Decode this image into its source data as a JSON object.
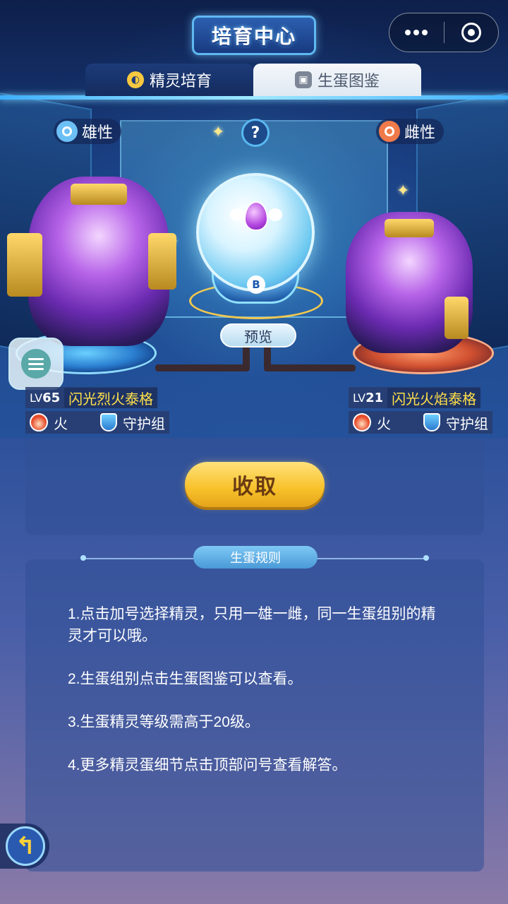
{
  "header": {
    "title": "培育中心",
    "capsule": {
      "more_icon": "more-dots-icon",
      "close_icon": "target-close-icon"
    }
  },
  "tabs": [
    {
      "label": "精灵培育",
      "active": true,
      "icon": "sprite-icon"
    },
    {
      "label": "生蛋图鉴",
      "active": false,
      "icon": "book-icon"
    }
  ],
  "parents": {
    "male": {
      "gender_label": "雄性",
      "level_prefix": "LV",
      "level": "65",
      "name": "闪光烈火泰格",
      "attribute": "火",
      "egg_group": "守护组"
    },
    "female": {
      "gender_label": "雌性",
      "level_prefix": "LV",
      "level": "21",
      "name": "闪光火焰泰格",
      "attribute": "火",
      "egg_group": "守护组"
    }
  },
  "center": {
    "help_label": "?",
    "egg_badge": "B",
    "preview_label": "预览"
  },
  "actions": {
    "collect_label": "收取"
  },
  "rules": {
    "title": "生蛋规则",
    "items": [
      "1.点击加号选择精灵，只用一雄一雌，同一生蛋组别的精灵才可以哦。",
      "2.生蛋组别点击生蛋图鉴可以查看。",
      "3.生蛋精灵等级需高于20级。",
      "4.更多精灵蛋细节点击顶部问号查看解答。"
    ]
  },
  "colors": {
    "accent_gold": "#f7c12a",
    "name_yellow": "#ffe04a",
    "male_blue": "#6cc0f5",
    "female_orange": "#f07a4a"
  }
}
